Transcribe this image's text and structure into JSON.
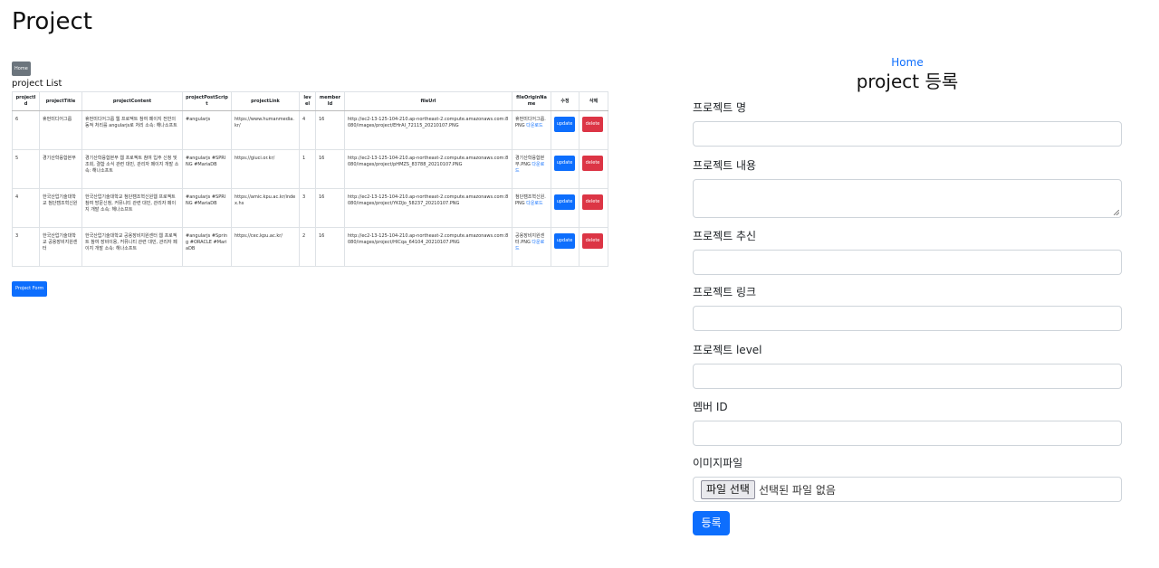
{
  "page": {
    "title": "Project"
  },
  "list": {
    "home_button": "Home",
    "title": "project List",
    "columns": [
      "projectId",
      "projectTitle",
      "projectContent",
      "projectPostScript",
      "projectLink",
      "level",
      "memberId",
      "fileUrl",
      "fileOriginName",
      "수정",
      "삭제"
    ],
    "rows": [
      {
        "projectId": "6",
        "projectTitle": "휴먼미디어그룹",
        "projectContent": "휴먼미디어그룹 웹 프로젝트 참여 페이지 전반의 동적 처리를 angularjs로 처리 소속: 해나소프트",
        "projectPostScript": "#angularjs",
        "projectLink": "https://www.humanmedia.kr/",
        "level": "4",
        "memberId": "16",
        "fileUrl": "http://ec2-13-125-104-210.ap-northeast-2.compute.amazonaws.com:8080/images/project/EHrAI_72115_20210107.PNG",
        "fileOriginName": "휴먼미디어그룹.PNG",
        "download": "다운로드",
        "update": "update",
        "delete": "delete"
      },
      {
        "projectId": "5",
        "projectTitle": "경기산학융합본부",
        "projectContent": "경기산학융합본부 웹 프로젝트 참여 입주 신청 및 조회, 결함 소식 관련 대민, 관리자 페이지 개발 소속: 해나소프트",
        "projectPostScript": "#angularjs #SPRING #MariaDB",
        "projectLink": "https://giuci.or.kr/",
        "level": "1",
        "memberId": "16",
        "fileUrl": "http://ec2-13-125-104-210.ap-northeast-2.compute.amazonaws.com:8080/images/project/pHMZS_83788_20210107.PNG",
        "fileOriginName": "경기산학융합본부.PNG",
        "download": "다운로드",
        "update": "update",
        "delete": "delete"
      },
      {
        "projectId": "4",
        "projectTitle": "한국산업기술대학교 첨단캠조혁신원",
        "projectContent": "한국산업기술대학교 첨단캠조혁신원웹 프로젝트 참여 방문신청, 커뮤니티 관련 대민, 관리자 페이지 개발 소속: 해나소프트",
        "projectPostScript": "#angularjs #SPRING #MariaDB",
        "projectLink": "https://amic.kpu.ac.kr/index.hs",
        "level": "3",
        "memberId": "16",
        "fileUrl": "http://ec2-13-125-104-210.ap-northeast-2.compute.amazonaws.com:8080/images/project/YKDJo_58237_20210107.PNG",
        "fileOriginName": "첨단캠조혁신원.PNG",
        "download": "다운로드",
        "update": "update",
        "delete": "delete"
      },
      {
        "projectId": "3",
        "projectTitle": "한국산업기술대학교 공용장비지원센터",
        "projectContent": "한국산업기술대학교 공용장비지원센터 웹 프로젝트 참여 장비이용, 커뮤니티 관련 대민, 관리자 페이지 개발 소속: 해나소프트",
        "projectPostScript": "#angularjs #Spring #ORACLE #MariaDB",
        "projectLink": "https://cec.kpu.ac.kr/",
        "level": "2",
        "memberId": "16",
        "fileUrl": "http://ec2-13-125-104-210.ap-northeast-2.compute.amazonaws.com:8080/images/project/HICqa_64104_20210107.PNG",
        "fileOriginName": "공용장비지원센터.PNG",
        "download": "다운로드",
        "update": "update",
        "delete": "delete"
      }
    ],
    "form_button": "Project Form"
  },
  "form": {
    "home_link": "Home",
    "title": "project 등록",
    "name_label": "프로젝트 명",
    "content_label": "프로젝트 내용",
    "postscript_label": "프로젝트 추신",
    "link_label": "프로젝트 링크",
    "level_label": "프로젝트 level",
    "member_label": "멤버 ID",
    "image_label": "이미지파일",
    "file_button": "파일 선택",
    "file_status": "선택된 파일 없음",
    "submit": "등록"
  },
  "colors": {
    "primary": "#0d6efd",
    "danger": "#dc3545",
    "secondary": "#6c757d"
  }
}
